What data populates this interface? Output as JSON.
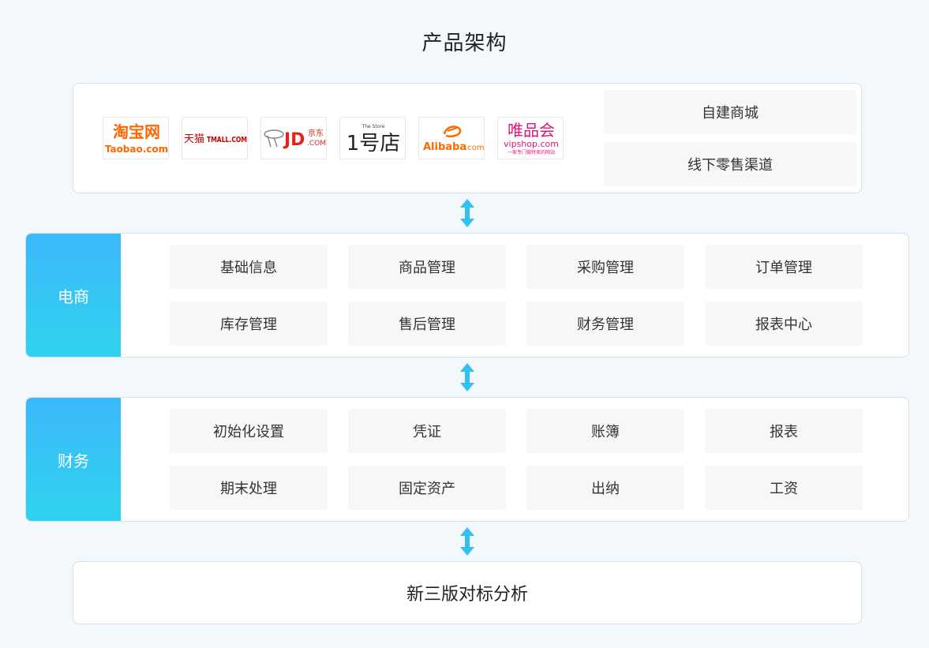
{
  "title": "产品架构",
  "channels": {
    "logos": [
      {
        "name": "taobao",
        "line1": "淘宝网",
        "line2": "Taobao.com",
        "color": "#ff6600"
      },
      {
        "name": "tmall",
        "line1": "天猫",
        "line2": "TMALL.COM",
        "color": "#c40000"
      },
      {
        "name": "jd",
        "line1": "JD",
        "line1b": "京东",
        "line2": ".COM",
        "color": "#e1251b"
      },
      {
        "name": "yhd",
        "line1": "1号店",
        "line2": "The Store",
        "color": "#222222"
      },
      {
        "name": "alibaba",
        "line1": "Alibaba",
        "line2": ".com",
        "color": "#ff6a00"
      },
      {
        "name": "vipshop",
        "line1": "唯品会",
        "line2": "vipshop.com",
        "line3": "一家专门做特卖的网站",
        "color": "#e0157b"
      }
    ],
    "own_mall": "自建商城",
    "offline": "线下零售渠道"
  },
  "ecommerce": {
    "label": "电商",
    "items": [
      "基础信息",
      "商品管理",
      "采购管理",
      "订单管理",
      "库存管理",
      "售后管理",
      "财务管理",
      "报表中心"
    ]
  },
  "finance": {
    "label": "财务",
    "items": [
      "初始化设置",
      "凭证",
      "账簿",
      "报表",
      "期末处理",
      "固定资产",
      "出纳",
      "工资"
    ]
  },
  "bottom": "新三版对标分析",
  "colors": {
    "accent": "#2fc1f3",
    "gradient_top": "#3cb8fb",
    "gradient_bottom": "#2fd3ee",
    "border": "#cfe3ee",
    "cell_bg": "#f7f7f7"
  }
}
